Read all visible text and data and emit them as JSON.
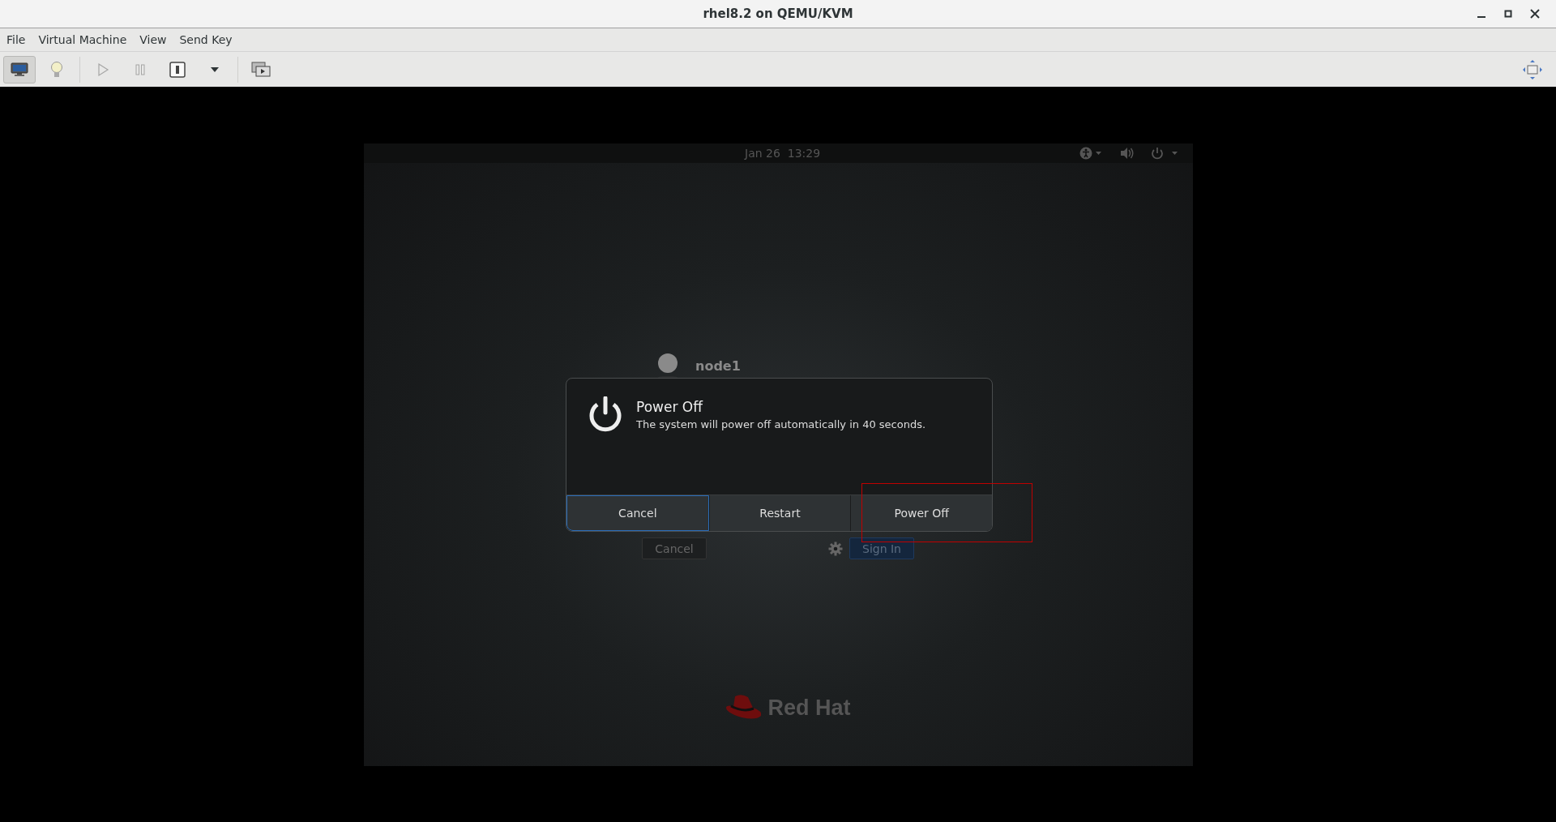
{
  "window": {
    "title": "rhel8.2 on QEMU/KVM"
  },
  "menu": [
    {
      "label": "File"
    },
    {
      "label": "Virtual Machine"
    },
    {
      "label": "View"
    },
    {
      "label": "Send Key"
    }
  ],
  "toolbar": [
    {
      "kind": "monitor",
      "selected": true,
      "disabled": false
    },
    {
      "kind": "bulb",
      "selected": false,
      "disabled": false
    },
    {
      "kind": "play",
      "selected": false,
      "disabled": true
    },
    {
      "kind": "pause",
      "selected": false,
      "disabled": true
    },
    {
      "kind": "shutdown",
      "selected": false,
      "disabled": false
    },
    {
      "kind": "dropdown",
      "selected": false,
      "disabled": false
    },
    {
      "kind": "console",
      "selected": false,
      "disabled": false
    }
  ],
  "guest": {
    "clock": "Jan 26  13:29",
    "login": {
      "user": "node1",
      "cancel": "Cancel",
      "sign_in": "Sign In"
    },
    "dialog": {
      "title": "Power Off",
      "message": "The system will power off automatically in 40 seconds.",
      "buttons": [
        {
          "label": "Cancel",
          "focused": true
        },
        {
          "label": "Restart",
          "focused": false
        },
        {
          "label": "Power Off",
          "focused": false
        }
      ]
    },
    "logo": "Red Hat"
  }
}
